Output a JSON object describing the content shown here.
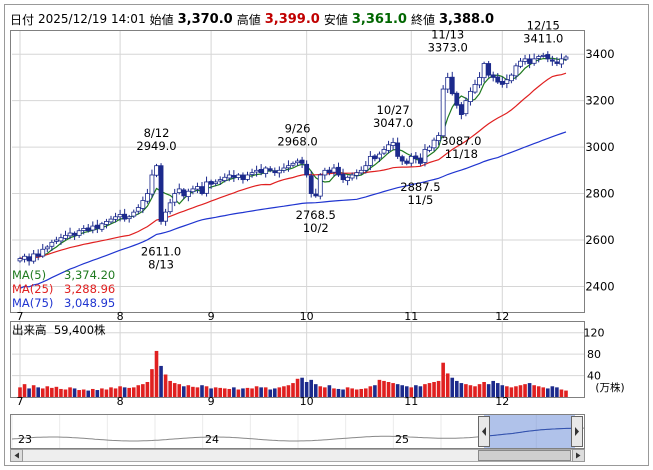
{
  "header": {
    "date_label": "日付",
    "datetime": "2025/12/19 14:01",
    "open_label": "始値",
    "open": "3,370.0",
    "high_label": "高値",
    "high": "3,399.0",
    "low_label": "安値",
    "low": "3,361.0",
    "close_label": "終値",
    "close": "3,388.0"
  },
  "colors": {
    "up": "#FFFFFF",
    "down": "#1C2A8C",
    "ma5": "#1F7A1F",
    "ma25": "#E02020",
    "ma75": "#2035D0",
    "vol_up": "#E02020",
    "vol_down": "#1C2A8C",
    "high_text": "#C00000",
    "low_text": "#006600"
  },
  "ma_legend": [
    {
      "name": "MA(5)",
      "value": "3,374.20",
      "color": "#1F7A1F"
    },
    {
      "name": "MA(25)",
      "value": "3,288.96",
      "color": "#E02020"
    },
    {
      "name": "MA(75)",
      "value": "3,048.95",
      "color": "#2035D0"
    }
  ],
  "volume_legend": {
    "label": "出来高",
    "value": "59,400株"
  },
  "volume_unit": "(万株)",
  "navigator": {
    "labels": [
      "23",
      "24",
      "25"
    ]
  },
  "chart_data": {
    "type": "candlestick",
    "price_axis": {
      "ticks": [
        2400,
        2600,
        2800,
        3000,
        3200,
        3400
      ],
      "ylim": [
        2290,
        3500
      ]
    },
    "volume_axis": {
      "ticks": [
        40,
        80,
        120
      ],
      "ylim": [
        0,
        140
      ],
      "unit": "万株"
    },
    "month_labels": [
      {
        "label": "7",
        "index": 0
      },
      {
        "label": "8",
        "index": 22
      },
      {
        "label": "9",
        "index": 42
      },
      {
        "label": "10",
        "index": 63
      },
      {
        "label": "11",
        "index": 86
      },
      {
        "label": "12",
        "index": 106
      }
    ],
    "annotations": [
      {
        "date": "8/12",
        "value": "2949.0",
        "index": 30,
        "pos": "above"
      },
      {
        "date": "8/13",
        "value": "2611.0",
        "index": 31,
        "pos": "below"
      },
      {
        "date": "9/26",
        "value": "2968.0",
        "index": 61,
        "pos": "above"
      },
      {
        "date": "10/2",
        "value": "2768.5",
        "index": 65,
        "pos": "below"
      },
      {
        "date": "10/27",
        "value": "3047.0",
        "index": 82,
        "pos": "above"
      },
      {
        "date": "11/5",
        "value": "2887.5",
        "index": 88,
        "pos": "below"
      },
      {
        "date": "11/13",
        "value": "3373.0",
        "index": 94,
        "pos": "above"
      },
      {
        "date": "11/18",
        "value": "3087.0",
        "index": 97,
        "pos": "below"
      },
      {
        "date": "12/15",
        "value": "3411.0",
        "index": 115,
        "pos": "above"
      }
    ],
    "closes": [
      2520,
      2530,
      2510,
      2540,
      2530,
      2560,
      2570,
      2590,
      2600,
      2610,
      2620,
      2630,
      2620,
      2640,
      2650,
      2640,
      2660,
      2650,
      2670,
      2680,
      2690,
      2700,
      2710,
      2690,
      2700,
      2720,
      2740,
      2770,
      2800,
      2880,
      2920,
      2680,
      2720,
      2760,
      2800,
      2820,
      2790,
      2810,
      2820,
      2830,
      2800,
      2850,
      2840,
      2850,
      2860,
      2870,
      2880,
      2870,
      2880,
      2860,
      2880,
      2890,
      2900,
      2890,
      2910,
      2900,
      2890,
      2900,
      2910,
      2920,
      2930,
      2940,
      2930,
      2880,
      2800,
      2790,
      2880,
      2900,
      2890,
      2910,
      2880,
      2860,
      2870,
      2880,
      2890,
      2900,
      2920,
      2960,
      2950,
      2970,
      2990,
      3010,
      3020,
      2960,
      2940,
      2930,
      2960,
      2950,
      2930,
      2990,
      3000,
      3030,
      3050,
      3250,
      3300,
      3230,
      3180,
      3140,
      3200,
      3240,
      3270,
      3300,
      3360,
      3310,
      3300,
      3280,
      3270,
      3290,
      3310,
      3350,
      3370,
      3380,
      3360,
      3380,
      3390,
      3395,
      3380,
      3370,
      3360,
      3380,
      3388
    ],
    "volumes": [
      18,
      24,
      16,
      22,
      18,
      16,
      20,
      17,
      19,
      15,
      14,
      18,
      16,
      13,
      14,
      12,
      15,
      13,
      16,
      14,
      18,
      16,
      20,
      18,
      17,
      18,
      22,
      24,
      28,
      52,
      86,
      58,
      42,
      30,
      26,
      24,
      20,
      22,
      19,
      18,
      22,
      20,
      16,
      18,
      17,
      16,
      15,
      18,
      14,
      16,
      17,
      16,
      20,
      18,
      18,
      14,
      16,
      18,
      20,
      22,
      26,
      34,
      36,
      28,
      32,
      24,
      20,
      18,
      22,
      16,
      15,
      14,
      18,
      16,
      14,
      15,
      16,
      20,
      22,
      32,
      30,
      28,
      26,
      24,
      22,
      20,
      18,
      22,
      20,
      24,
      26,
      28,
      30,
      64,
      44,
      36,
      30,
      26,
      24,
      22,
      20,
      24,
      28,
      24,
      30,
      26,
      22,
      20,
      18,
      20,
      22,
      24,
      26,
      22,
      20,
      18,
      16,
      20,
      18,
      14,
      12
    ]
  }
}
